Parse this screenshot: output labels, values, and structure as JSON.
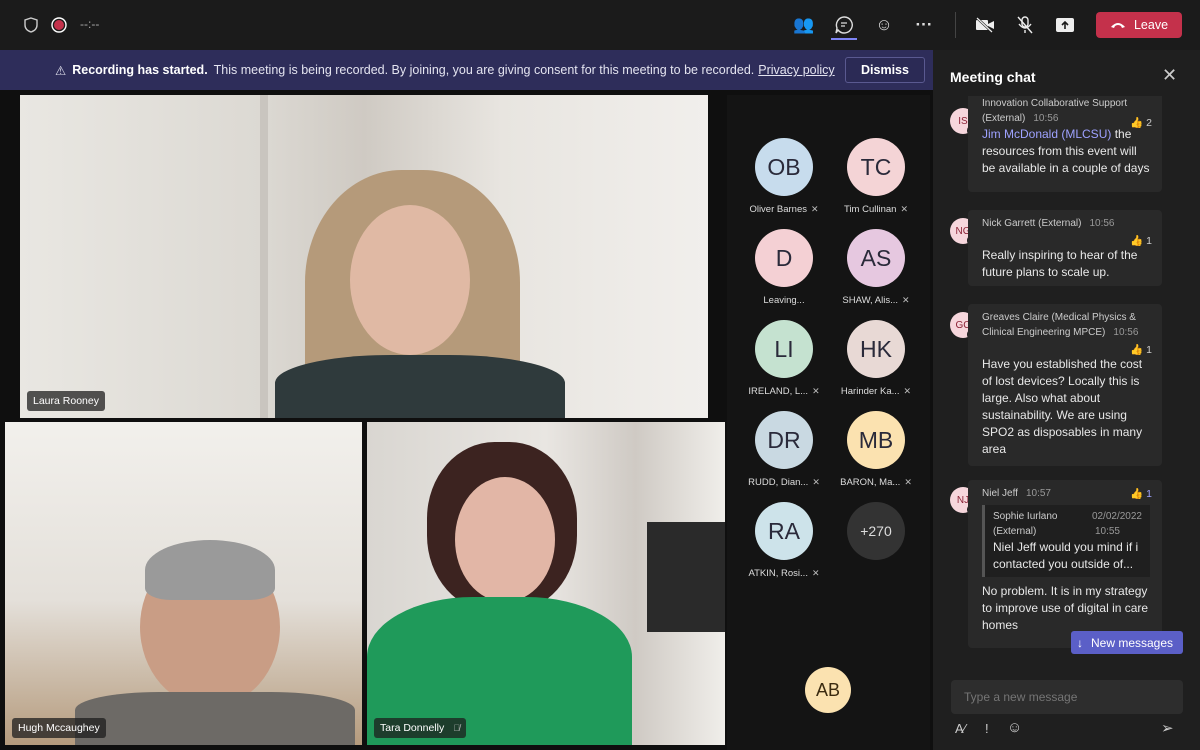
{
  "topbar": {
    "timer": "--:--",
    "leave_label": "Leave",
    "icons": [
      "shield-icon",
      "record-icon",
      "people-icon",
      "chat-icon",
      "reactions-icon",
      "more-icon",
      "camera-off-icon",
      "mic-off-icon",
      "share-icon",
      "phone-icon"
    ]
  },
  "banner": {
    "title": "Recording has started.",
    "text": "This meeting is being recorded. By joining, you are giving consent for this meeting to be recorded.",
    "link": "Privacy policy",
    "dismiss": "Dismiss"
  },
  "videos": [
    {
      "name": "Laura Rooney"
    },
    {
      "name": "Hugh Mccaughey"
    },
    {
      "name": "Tara Donnelly",
      "muted": true
    }
  ],
  "participants": [
    {
      "initials": "OB",
      "name": "Oliver Barnes",
      "color": "#c7dced",
      "muted": true
    },
    {
      "initials": "TC",
      "name": "Tim Cullinan",
      "color": "#f4d4d6",
      "muted": true
    },
    {
      "initials": "D",
      "name": "Leaving...",
      "color": "#f4d0d4",
      "muted": false
    },
    {
      "initials": "AS",
      "name": "SHAW, Alis...",
      "color": "#e6c8e0",
      "muted": true
    },
    {
      "initials": "LI",
      "name": "IRELAND, L...",
      "color": "#c5e2d0",
      "muted": true
    },
    {
      "initials": "HK",
      "name": "Harinder Ka...",
      "color": "#e8d9d5",
      "muted": true
    },
    {
      "initials": "DR",
      "name": "RUDD, Dian...",
      "color": "#c9d9e2",
      "muted": true
    },
    {
      "initials": "MB",
      "name": "BARON, Ma...",
      "color": "#fbe2b0",
      "muted": true
    },
    {
      "initials": "RA",
      "name": "ATKIN, Rosi...",
      "color": "#cde3ea",
      "muted": true
    }
  ],
  "more_count": "+270",
  "self_avatar": "AB",
  "chat": {
    "title": "Meeting chat",
    "messages": [
      {
        "initials": "IS",
        "sender": "Innovation Collaborative Support",
        "sender2": "(External)",
        "time": "10:56",
        "likes": "2",
        "mention": "Jim McDonald (MLCSU)",
        "text": " the resources from this event will be available in a couple of days"
      },
      {
        "initials": "NG",
        "sender": "Nick Garrett (External)",
        "time": "10:56",
        "likes": "1",
        "text": "Really inspiring to hear of the future plans to scale up."
      },
      {
        "initials": "GC",
        "sender": "Greaves Claire (Medical Physics & Clinical Engineering MPCE)",
        "time": "10:56",
        "likes": "1",
        "text": "Have you established the cost of lost devices? Locally this is large. Also what about sustainability. We are using SPO2 as disposables in many area"
      },
      {
        "initials": "NJ",
        "sender": "Niel Jeff",
        "time": "10:57",
        "likes": "1",
        "quote": {
          "sender": "Sophie Iurlano",
          "sender2": "(External)",
          "date": "02/02/2022",
          "time": "10:55",
          "text": "Niel Jeff would you mind if i contacted you outside of..."
        },
        "text": "No problem. It is in my strategy to improve use of digital in care homes"
      }
    ],
    "new_messages": "New messages",
    "input_placeholder": "Type a new message"
  },
  "colors": {
    "leave": "#c4314b",
    "banner": "#2e2d5a",
    "accent": "#5b5fc7"
  }
}
